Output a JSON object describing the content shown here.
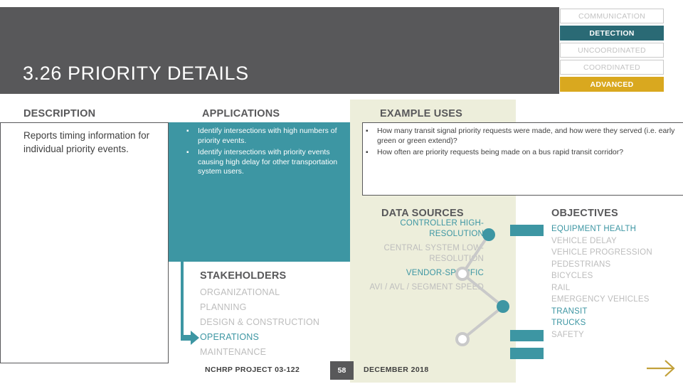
{
  "header": {
    "title": "3.26 PRIORITY DETAILS"
  },
  "badges": [
    {
      "label": "COMMUNICATION",
      "state": "off"
    },
    {
      "label": "DETECTION",
      "state": "on-teal"
    },
    {
      "label": "UNCOORDINATED",
      "state": "off"
    },
    {
      "label": "COORDINATED",
      "state": "off"
    },
    {
      "label": "ADVANCED",
      "state": "on-gold"
    }
  ],
  "description": {
    "heading": "DESCRIPTION",
    "text": "Reports timing information for individual priority events."
  },
  "applications": {
    "heading": "APPLICATIONS",
    "bullet": "▪",
    "items": [
      "Identify intersections with high numbers of priority events.",
      "Identify intersections with priority events causing high delay for other transportation system users."
    ]
  },
  "example_uses": {
    "heading": "EXAMPLE USES",
    "bullet": "▪",
    "items": [
      "How many transit signal priority requests were made, and how were they served (i.e. early green or green extend)?",
      "How often are priority requests being made on a bus rapid transit corridor?"
    ]
  },
  "stakeholders": {
    "heading": "STAKEHOLDERS",
    "items": [
      {
        "label": "ORGANIZATIONAL",
        "active": false
      },
      {
        "label": "PLANNING",
        "active": false
      },
      {
        "label": "DESIGN & CONSTRUCTION",
        "active": false
      },
      {
        "label": "OPERATIONS",
        "active": true
      },
      {
        "label": "MAINTENANCE",
        "active": false
      }
    ]
  },
  "data_sources": {
    "heading": "DATA SOURCES",
    "items": [
      {
        "label": "CONTROLLER HIGH-RESOLUTION",
        "active": true
      },
      {
        "label": "CENTRAL SYSTEM LOW-RESOLUTION",
        "active": false
      },
      {
        "label": "VENDOR-SPECIFIC",
        "active": true
      },
      {
        "label": "AVI / AVL / SEGMENT SPEED",
        "active": false
      }
    ],
    "nodes": [
      {
        "filled": true
      },
      {
        "filled": false
      },
      {
        "filled": true
      },
      {
        "filled": false
      }
    ]
  },
  "objectives": {
    "heading": "OBJECTIVES",
    "items": [
      {
        "label": "EQUIPMENT HEALTH",
        "active": true
      },
      {
        "label": "VEHICLE DELAY",
        "active": false
      },
      {
        "label": "VEHICLE PROGRESSION",
        "active": false
      },
      {
        "label": "PEDESTRIANS",
        "active": false
      },
      {
        "label": "BICYCLES",
        "active": false
      },
      {
        "label": "RAIL",
        "active": false
      },
      {
        "label": "EMERGENCY VEHICLES",
        "active": false
      },
      {
        "label": "TRANSIT",
        "active": true
      },
      {
        "label": "TRUCKS",
        "active": true
      },
      {
        "label": "SAFETY",
        "active": false
      }
    ]
  },
  "footer": {
    "project": "NCHRP PROJECT 03-122",
    "page": "58",
    "date": "DECEMBER 2018"
  },
  "colors": {
    "teal": "#3d96a3",
    "dark_teal": "#2a6a75",
    "gold": "#d9a81f",
    "dark_gray": "#58585a",
    "beige": "#edeedb",
    "muted": "#bdbdbd"
  }
}
